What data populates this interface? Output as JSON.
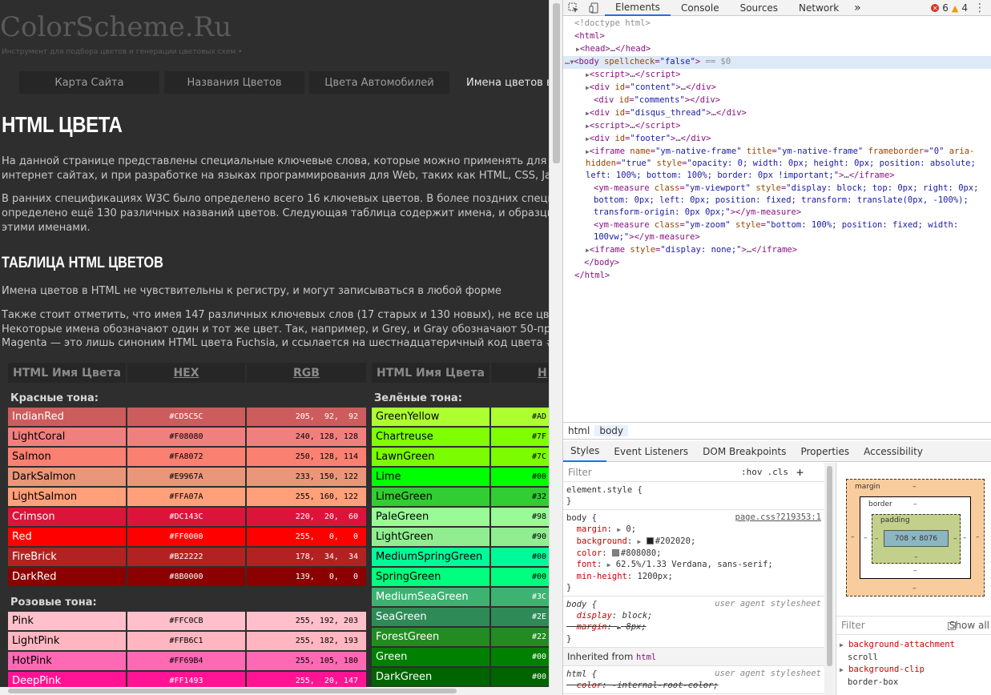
{
  "page": {
    "logo": "ColorScheme.Ru",
    "tagline": "Инструмент для подбора цветов и генерации цветовых схем •",
    "nav": [
      "Карта Сайта",
      "Названия Цветов",
      "Цвета Автомобилей",
      "Имена цветов в H"
    ],
    "title": "HTML ЦВЕТА",
    "p1": [
      "На данной странице представлены специальные ключевые слова, которые можно применять для об",
      "интернет сайтах, и при разработке на языках программирования для Web, таких как HTML, CSS, Ja"
    ],
    "p2": [
      "В ранних спецификациях W3C было определено всего 16 ключевых цветов. В более поздних специ",
      "определено ещё 130 различных названий цветов. Следующая таблица содержит имена, и образцы",
      "этими именами."
    ],
    "subtitle": "ТАБЛИЦА HTML ЦВЕТОВ",
    "p3": "Имена цветов в HTML не чувствительны к регистру, и могут записываться в любой форме",
    "p4": [
      "Также стоит отметить, что имея 147 различных ключевых слов (17 старых и 130 новых), не все цве",
      "Некоторые имена обозначают один и тот же цвет. Так, например, и Grey, и Gray обозначают 50-про",
      "Magenta — это лишь синоним HTML цвета Fuchsia, и ссылается на шестнадцатеричный код цвета #F"
    ],
    "table_headers": [
      "HTML Имя Цвета",
      "HEX",
      "RGB"
    ],
    "right_headers": [
      "HTML Имя Цвета",
      "H"
    ],
    "left_groups": [
      {
        "title": "Красные тона:",
        "rows": [
          {
            "name": "IndianRed",
            "hex": "#CD5C5C",
            "rgb": "205,  92,  92"
          },
          {
            "name": "LightCoral",
            "hex": "#F08080",
            "rgb": "240, 128, 128"
          },
          {
            "name": "Salmon",
            "hex": "#FA8072",
            "rgb": "250, 128, 114"
          },
          {
            "name": "DarkSalmon",
            "hex": "#E9967A",
            "rgb": "233, 150, 122"
          },
          {
            "name": "LightSalmon",
            "hex": "#FFA07A",
            "rgb": "255, 160, 122"
          },
          {
            "name": "Crimson",
            "hex": "#DC143C",
            "rgb": "220,  20,  60"
          },
          {
            "name": "Red",
            "hex": "#FF0000",
            "rgb": "255,   0,   0"
          },
          {
            "name": "FireBrick",
            "hex": "#B22222",
            "rgb": "178,  34,  34"
          },
          {
            "name": "DarkRed",
            "hex": "#8B0000",
            "rgb": "139,   0,   0"
          }
        ]
      },
      {
        "title": "Розовые тона:",
        "rows": [
          {
            "name": "Pink",
            "hex": "#FFC0CB",
            "rgb": "255, 192, 203"
          },
          {
            "name": "LightPink",
            "hex": "#FFB6C1",
            "rgb": "255, 182, 193"
          },
          {
            "name": "HotPink",
            "hex": "#FF69B4",
            "rgb": "255, 105, 180"
          },
          {
            "name": "DeepPink",
            "hex": "#FF1493",
            "rgb": "255,  20, 147"
          }
        ]
      }
    ],
    "right_group_title": "Зелёные тона:",
    "right_rows": [
      {
        "name": "GreenYellow",
        "hex": "#AD",
        "color": "#ADFF2F",
        "fg": "#000000"
      },
      {
        "name": "Chartreuse",
        "hex": "#7F",
        "color": "#7FFF00",
        "fg": "#000000"
      },
      {
        "name": "LawnGreen",
        "hex": "#7C",
        "color": "#7CFC00",
        "fg": "#000000"
      },
      {
        "name": "Lime",
        "hex": "#00",
        "color": "#00FF00",
        "fg": "#000000"
      },
      {
        "name": "LimeGreen",
        "hex": "#32",
        "color": "#32CD32",
        "fg": "#000000"
      },
      {
        "name": "PaleGreen",
        "hex": "#98",
        "color": "#98FB98",
        "fg": "#000000"
      },
      {
        "name": "LightGreen",
        "hex": "#90",
        "color": "#90EE90",
        "fg": "#000000"
      },
      {
        "name": "MediumSpringGreen",
        "hex": "#00",
        "color": "#00FA9A",
        "fg": "#000000"
      },
      {
        "name": "SpringGreen",
        "hex": "#00",
        "color": "#00FF7F",
        "fg": "#000000"
      },
      {
        "name": "MediumSeaGreen",
        "hex": "#3C",
        "color": "#3CB371",
        "fg": "#ffffff"
      },
      {
        "name": "SeaGreen",
        "hex": "#2E",
        "color": "#2E8B57",
        "fg": "#ffffff"
      },
      {
        "name": "ForestGreen",
        "hex": "#22",
        "color": "#228B22",
        "fg": "#ffffff"
      },
      {
        "name": "Green",
        "hex": "#00",
        "color": "#008000",
        "fg": "#ffffff"
      },
      {
        "name": "DarkGreen",
        "hex": "#00",
        "color": "#006400",
        "fg": "#ffffff"
      }
    ]
  },
  "devtools": {
    "tabs": [
      "Elements",
      "Console",
      "Sources",
      "Network"
    ],
    "more_tabs": "»",
    "error_count": "6",
    "warning_count": "4",
    "breadcrumbs": [
      "html",
      "body"
    ],
    "subtabs": [
      "Styles",
      "Event Listeners",
      "DOM Breakpoints",
      "Properties",
      "Accessibility"
    ],
    "filter_placeholder": "Filter",
    "hov": ":hov",
    "cls": ".cls",
    "plus": "+",
    "element_style": "element.style {",
    "close_brace": "}",
    "body_source": "page.css?219353:1",
    "user_agent": "user agent stylesheet",
    "inherited_label": "Inherited from",
    "inherited_tag": "html",
    "box": {
      "margin": "margin",
      "border": "border",
      "padding": "padding",
      "content": "708 × 8076",
      "dash": "–"
    },
    "computed_filter": "Filter",
    "show_all": "Show all",
    "computed": [
      {
        "prop": "background-attachment",
        "value": "scroll"
      },
      {
        "prop": "background-clip",
        "value": "border-box"
      }
    ]
  },
  "colors": {
    "accent": "#1a73e8",
    "page_bg": "#2e2e2e",
    "header_bg": "#262626"
  }
}
